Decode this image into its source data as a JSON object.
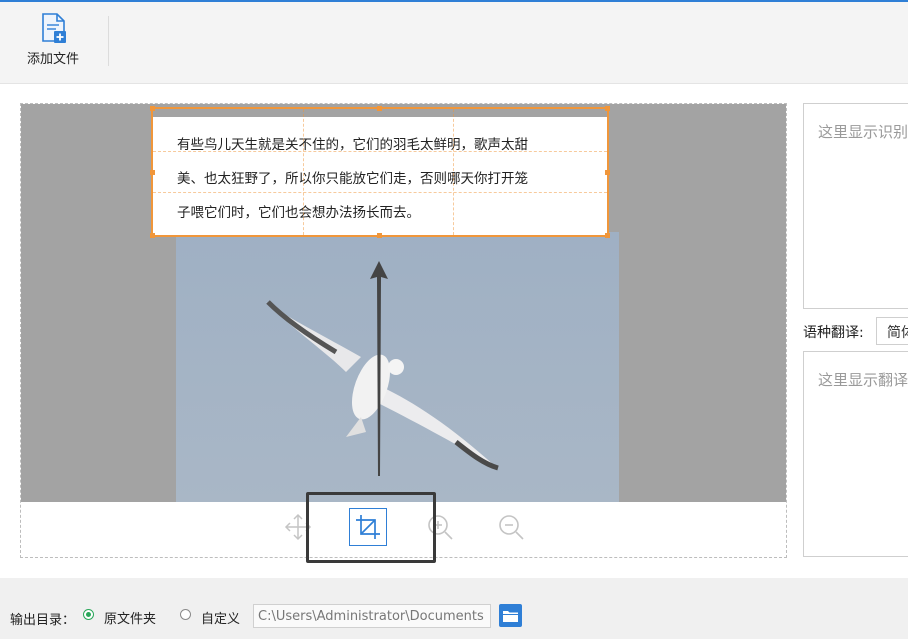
{
  "toolbar": {
    "add_file_label": "添加文件"
  },
  "recognized_text": {
    "lines": [
      "有些鸟儿天生就是关不住的，它们的羽毛太鲜明，歌声太甜",
      "美、也太狂野了，所以你只能放它们走，否则哪天你打开笼",
      "子喂它们时，它们也会想办法扬长而去。"
    ]
  },
  "tools": [
    {
      "icon": "move-icon",
      "active": false
    },
    {
      "icon": "crop-icon",
      "active": true
    },
    {
      "icon": "zoom-in-icon",
      "active": false
    },
    {
      "icon": "zoom-out-icon",
      "active": false
    }
  ],
  "right_panel": {
    "ocr_placeholder": "这里显示识别",
    "language_label": "语种翻译:",
    "language_value": "简体",
    "translate_placeholder": "这里显示翻译"
  },
  "output": {
    "label": "输出目录：",
    "options": [
      {
        "label": "原文件夹",
        "checked": true
      },
      {
        "label": "自定义",
        "checked": false
      }
    ],
    "path": "C:\\Users\\Administrator\\Documents"
  },
  "colors": {
    "accent": "#2f7fd6",
    "crop_border": "#f0963a",
    "radio_checked": "#2aa75a"
  }
}
